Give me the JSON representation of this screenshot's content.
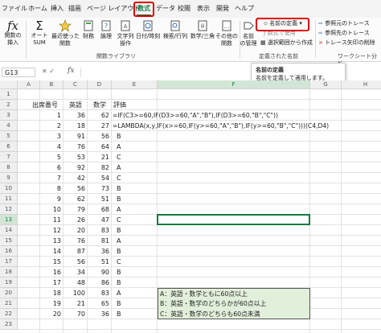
{
  "tabs": [
    "ファイル",
    "ホーム",
    "挿入",
    "描画",
    "ページ レイアウト",
    "数式",
    "データ",
    "校閲",
    "表示",
    "開発",
    "ヘルプ"
  ],
  "ribbon": {
    "insert_fn": "関数の\n挿入",
    "autosum": "オート\nSUM",
    "recent": "最近使った\n関数",
    "finance": "財務",
    "logical": "論理",
    "text": "文字列\n操作",
    "datetime": "日付/時刻",
    "lookup": "検索/行列",
    "math": "数学/三角",
    "more": "その他の\n関数",
    "name_mgr": "名前\nの管理",
    "group_lib": "関数ライブラリ",
    "define_name": "名前の定義",
    "use_in_formula": "数式で使用",
    "create_from_sel": "選択範囲から作成",
    "group_names": "定義された名前",
    "trace_prec": "参照元のトレース",
    "trace_dep": "参照先のトレース",
    "remove_arrows": "トレース矢印の削除",
    "group_audit": "ワークシート分析"
  },
  "tooltip": {
    "title": "名前の定義",
    "body": "名前を定義して適用します。"
  },
  "formula_bar": {
    "name_box": "G13",
    "fx": "fx",
    "value": ""
  },
  "columns": [
    "A",
    "B",
    "C",
    "D",
    "E",
    "F",
    "G",
    "H",
    "I"
  ],
  "rows": [
    "1",
    "2",
    "3",
    "4",
    "5",
    "6",
    "7",
    "8",
    "9",
    "10",
    "11",
    "12",
    "13",
    "14",
    "15",
    "16",
    "17",
    "18",
    "19",
    "20",
    "21",
    "22",
    "23"
  ],
  "headers": {
    "b": "出席番号",
    "c": "英語",
    "d": "数学",
    "e": "評価"
  },
  "data": [
    {
      "b": "1",
      "c": "36",
      "d": "62",
      "e": "=IF(C3>=60,IF(D3>=60,\"A\",\"B\"),IF(D3>=60,\"B\",\"C\"))"
    },
    {
      "b": "2",
      "c": "18",
      "d": "27",
      "e": "=LAMBDA(x,y,IF(x>=60,IF(y>=60,\"A\",\"B\"),IF(y>=60,\"B\",\"C\")))(C4,D4)"
    },
    {
      "b": "3",
      "c": "91",
      "d": "56",
      "e": "B"
    },
    {
      "b": "4",
      "c": "76",
      "d": "64",
      "e": "A"
    },
    {
      "b": "5",
      "c": "53",
      "d": "21",
      "e": "C"
    },
    {
      "b": "6",
      "c": "92",
      "d": "82",
      "e": "A"
    },
    {
      "b": "7",
      "c": "42",
      "d": "54",
      "e": "C"
    },
    {
      "b": "8",
      "c": "56",
      "d": "73",
      "e": "B"
    },
    {
      "b": "9",
      "c": "62",
      "d": "51",
      "e": "B"
    },
    {
      "b": "10",
      "c": "79",
      "d": "68",
      "e": "A"
    },
    {
      "b": "11",
      "c": "26",
      "d": "47",
      "e": "C"
    },
    {
      "b": "12",
      "c": "20",
      "d": "83",
      "e": "B"
    },
    {
      "b": "13",
      "c": "76",
      "d": "81",
      "e": "A"
    },
    {
      "b": "14",
      "c": "87",
      "d": "36",
      "e": "B"
    },
    {
      "b": "15",
      "c": "56",
      "d": "51",
      "e": "C"
    },
    {
      "b": "16",
      "c": "34",
      "d": "90",
      "e": "B"
    },
    {
      "b": "17",
      "c": "48",
      "d": "86",
      "e": "B"
    },
    {
      "b": "18",
      "c": "100",
      "d": "83",
      "e": "A"
    },
    {
      "b": "19",
      "c": "21",
      "d": "65",
      "e": "B"
    },
    {
      "b": "20",
      "c": "70",
      "d": "36",
      "e": "B"
    }
  ],
  "legend": [
    "A：英語・数学ともに60点以上",
    "B：英語・数学のどちらかが60点以上",
    "C：英語・数学のどちらも60点未満"
  ],
  "colors": {
    "accent": "#107c41",
    "highlight": "#e00000",
    "legend_bg": "#e2efda"
  }
}
